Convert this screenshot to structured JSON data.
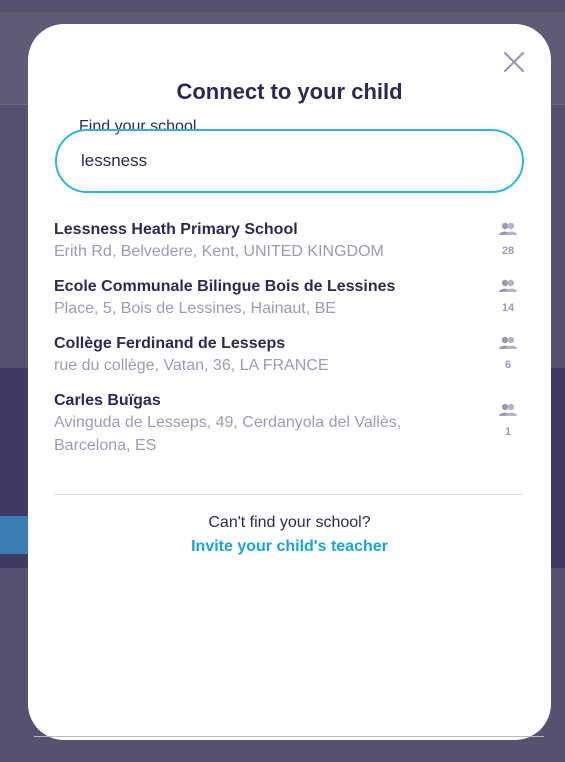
{
  "modal": {
    "title": "Connect to your child",
    "close_icon": "close-icon",
    "field_label": "Find your school",
    "search_value": "lessness"
  },
  "results": [
    {
      "name": "Lessness Heath Primary School",
      "address": "Erith Rd, Belvedere, Kent, UNITED KINGDOM",
      "count": "28",
      "icon": "people-icon"
    },
    {
      "name": "Ecole Communale Bilingue Bois de Lessines",
      "address": "Place, 5, Bois de Lessines, Hainaut, BE",
      "count": "14",
      "icon": "people-icon"
    },
    {
      "name": "Collège Ferdinand de Lesseps",
      "address": "rue du collège, Vatan, 36, LA FRANCE",
      "count": "6",
      "icon": "people-icon"
    },
    {
      "name": "Carles Buïgas",
      "address": "Avinguda de Lesseps, 49, Cerdanyola del Vallès, Barcelona, ES",
      "count": "1",
      "icon": "people-icon"
    }
  ],
  "footer": {
    "cant_find": "Can't find your school?",
    "invite_link": "Invite your child's teacher"
  },
  "colors": {
    "accent": "#2eb6e0",
    "link": "#1aa3d8",
    "title_text": "#2c2a50",
    "muted_text": "#9d9bb2",
    "overlay": "#54526e"
  }
}
